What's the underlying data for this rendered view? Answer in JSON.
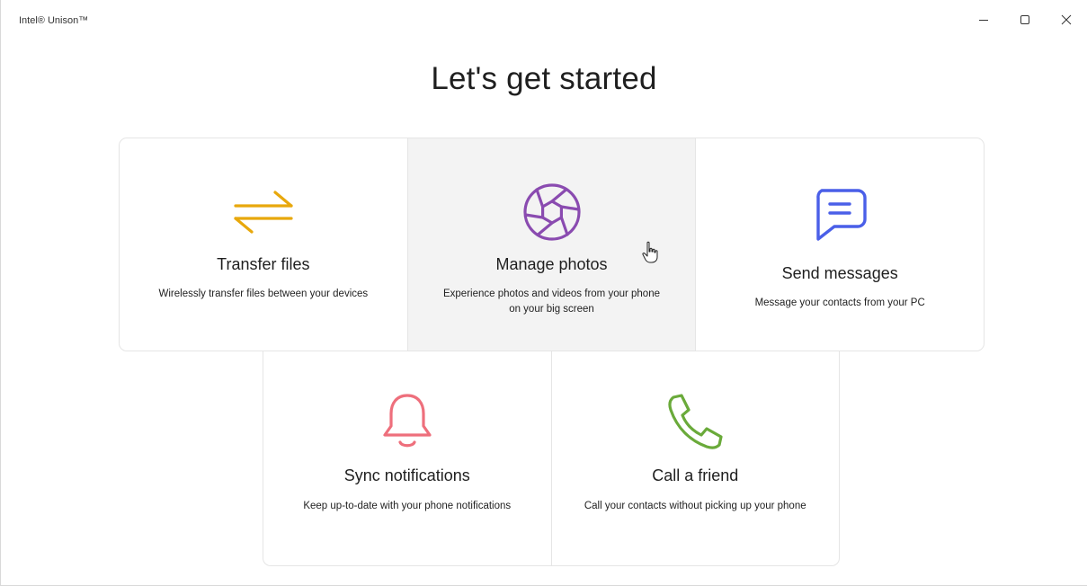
{
  "window": {
    "title": "Intel® Unison™",
    "controls": {
      "minimize_icon": "minimize-icon",
      "maximize_icon": "maximize-icon",
      "close_icon": "close-icon"
    }
  },
  "page": {
    "title": "Let's get started"
  },
  "cards": {
    "transfer": {
      "icon": "transfer-arrows-icon",
      "title": "Transfer files",
      "description": "Wirelessly transfer files between your devices",
      "color": "#e8a80c"
    },
    "photos": {
      "icon": "aperture-icon",
      "title": "Manage photos",
      "description": "Experience photos and videos from your phone on your big screen",
      "color": "#8a4bb0"
    },
    "messages": {
      "icon": "chat-bubble-icon",
      "title": "Send messages",
      "description": "Message your contacts from your PC",
      "color": "#4a5fe8"
    },
    "notifications": {
      "icon": "bell-icon",
      "title": "Sync notifications",
      "description": "Keep up-to-date with your phone notifications",
      "color": "#ee6f7c"
    },
    "call": {
      "icon": "phone-icon",
      "title": "Call a friend",
      "description": "Call your contacts without picking up your phone",
      "color": "#6aaa3a"
    }
  },
  "colors": {
    "card_hover_background": "#f3f3f3",
    "card_border": "#e5e5e5"
  }
}
